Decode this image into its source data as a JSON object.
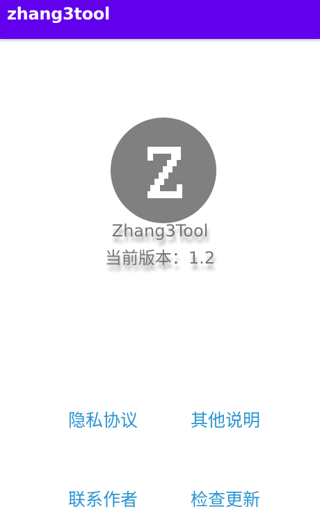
{
  "app_bar": {
    "title": "zhang3tool",
    "color": "#6200ee"
  },
  "logo": {
    "letter": "Z",
    "background": "#808080",
    "icon": "z-logo-icon"
  },
  "about": {
    "app_name": "Zhang3Tool",
    "version_label": "当前版本：",
    "version": "1.2"
  },
  "links": {
    "privacy": "隐私协议",
    "other": "其他说明",
    "contact": "联系作者",
    "update": "检查更新",
    "color": "#2a95d0"
  }
}
